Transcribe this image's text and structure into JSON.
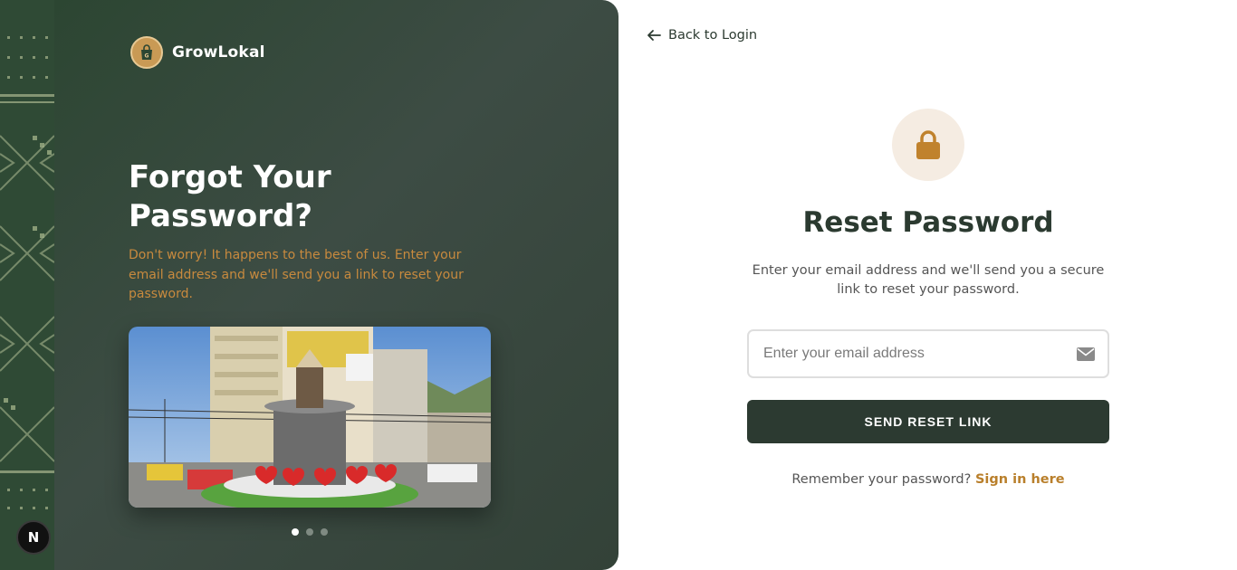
{
  "brand": {
    "name": "GrowLokal",
    "logo_icon": "shopping-bag-icon"
  },
  "hero": {
    "title_line1": "Forgot Your",
    "title_line2": "Password?",
    "subtitle": "Don't worry! It happens to the best of us. Enter your email address and we'll send you a link to reset your password.",
    "carousel": {
      "slide_count": 3,
      "active_index": 0
    }
  },
  "dev_badge": {
    "label": "N"
  },
  "nav": {
    "back_label": "Back to Login",
    "back_icon": "arrow-left-icon"
  },
  "form": {
    "icon": "lock-icon",
    "title": "Reset Password",
    "description": "Enter your email address and we'll send you a secure link to reset your password.",
    "email": {
      "placeholder": "Enter your email address",
      "value": "",
      "icon": "envelope-icon"
    },
    "submit_label": "SEND RESET LINK",
    "remember_text": "Remember your password?",
    "sign_in_label": "Sign in here"
  },
  "colors": {
    "primary_dark": "#2c3a31",
    "accent_gold": "#b97f2b",
    "hero_bg": "#3a4b40",
    "subtitle_orange": "#c88a3e",
    "lock_bg": "#f5ece2"
  }
}
